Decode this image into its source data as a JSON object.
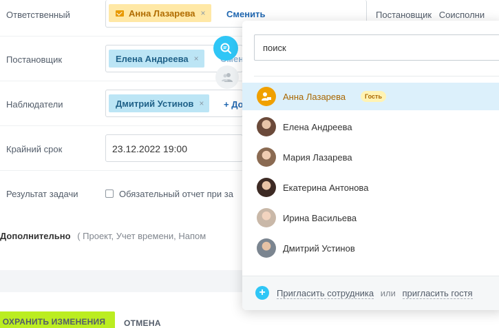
{
  "fields": {
    "responsible": {
      "label": "Ответственный",
      "person": "Анна Лазарева",
      "change": "Сменить"
    },
    "creator": {
      "label": "Постановщик",
      "person": "Елена Андреева",
      "change_partial": "Смен"
    },
    "observers": {
      "label": "Наблюдатели",
      "person": "Дмитрий Устинов",
      "add_partial": "+ До"
    },
    "deadline": {
      "label": "Крайний срок",
      "value": "23.12.2022 19:00"
    },
    "result": {
      "label": "Результат задачи",
      "checkbox": "Обязательный отчет при за"
    }
  },
  "remove_glyph": "×",
  "top_tabs": [
    "Постановщик",
    "Соисполни"
  ],
  "additional": {
    "title": "Дополнительно",
    "rest": "( Проект,  Учет времени,  Напом"
  },
  "buttons": {
    "save": "ОХРАНИТЬ ИЗМЕНЕНИЯ",
    "cancel": "ОТМЕНА"
  },
  "popup": {
    "search_value": "поиск",
    "people": [
      {
        "name": "Анна Лазарева",
        "badge": "Гость",
        "active": true
      },
      {
        "name": "Елена Андреева"
      },
      {
        "name": "Мария Лазарева"
      },
      {
        "name": "Екатерина Антонова"
      },
      {
        "name": "Ирина Васильева"
      },
      {
        "name": "Дмитрий Устинов"
      }
    ],
    "footer": {
      "invite": "Пригласить сотрудника",
      "or": "или",
      "guest": "пригласить гостя"
    }
  },
  "colors": {
    "accent_blue": "#2fc6f6",
    "guest_orange": "#e89a00",
    "save_green": "#bbed21",
    "chip_blue": "#bce5f5",
    "chip_orange": "#ffe8a6"
  }
}
